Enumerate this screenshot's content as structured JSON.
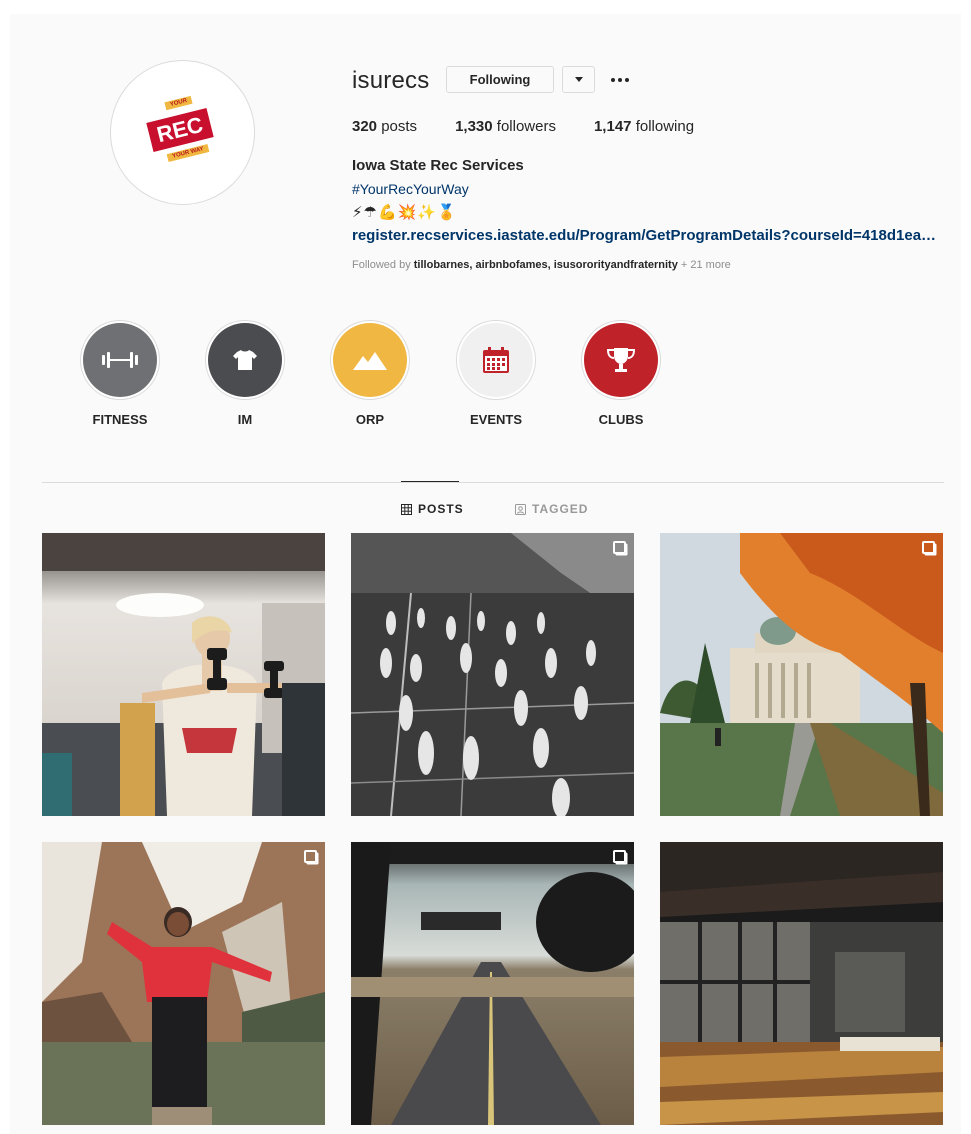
{
  "profile": {
    "username": "isurecs",
    "following_button": "Following",
    "stats": {
      "posts_count": "320",
      "posts_label": "posts",
      "followers_count": "1,330",
      "followers_label": "followers",
      "following_count": "1,147",
      "following_label": "following"
    },
    "full_name": "Iowa State Rec Services",
    "hashtag": "#YourRecYourWay",
    "emoji_line": "⚡☂💪💥✨🏅",
    "bio_link": "register.recservices.iastate.edu/Program/GetProgramDetails?courseId=418d1ea1-5...",
    "followed_by_prefix": "Followed by",
    "followed_by_users": "tillobarnes, airbnbofames, isusororityandfraternity",
    "followed_by_more": "+ 21 more",
    "logo": {
      "top_text": "YOUR",
      "main_text": "REC",
      "bottom_text": "YOUR WAY",
      "red": "#c8102e",
      "gold": "#f0b840"
    }
  },
  "highlights": [
    {
      "label": "FITNESS",
      "icon": "dumbbell-icon",
      "color": "#6f7074"
    },
    {
      "label": "IM",
      "icon": "tshirt-icon",
      "color": "#4b4c50"
    },
    {
      "label": "ORP",
      "icon": "mountain-icon",
      "color": "#f0b743"
    },
    {
      "label": "EVENTS",
      "icon": "calendar-icon",
      "color": "#f0f0f0"
    },
    {
      "label": "CLUBS",
      "icon": "trophy-icon",
      "color": "#c0222a"
    }
  ],
  "tabs": {
    "posts": "POSTS",
    "tagged": "TAGGED"
  },
  "posts": [
    {
      "subject": "fitness class with dumbbells",
      "multiple": false
    },
    {
      "subject": "vintage black and white gym basketball",
      "multiple": true
    },
    {
      "subject": "campus building with autumn tree",
      "multiple": true
    },
    {
      "subject": "woman posing in front of waterfall canyon",
      "multiple": true
    },
    {
      "subject": "open road through car windshield",
      "multiple": true
    },
    {
      "subject": "empty studio with wooden floor",
      "multiple": false
    }
  ]
}
